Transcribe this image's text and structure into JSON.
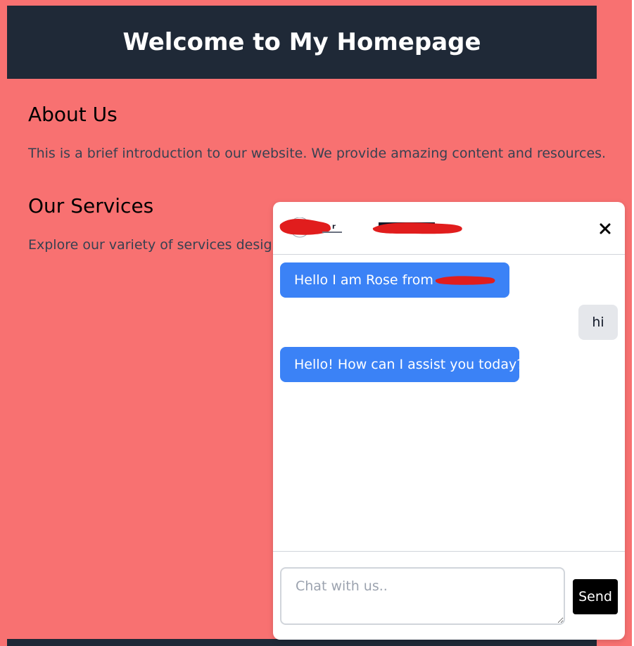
{
  "header": {
    "title": "Welcome to My Homepage"
  },
  "about": {
    "heading": "About Us",
    "text": "This is a brief introduction to our website. We provide amazing content and resources."
  },
  "services": {
    "heading": "Our Services",
    "text": "Explore our variety of services designed"
  },
  "chat": {
    "close_icon": "close-icon",
    "messages": [
      {
        "role": "bot",
        "text": "Hello I am Rose from"
      },
      {
        "role": "user",
        "text": "hi"
      },
      {
        "role": "bot",
        "text": "Hello! How can I assist you today?"
      }
    ],
    "input": {
      "placeholder": "Chat with us..",
      "value": ""
    },
    "send_label": "Send"
  },
  "colors": {
    "page_bg": "#f87171",
    "header_bg": "#1f2937",
    "bot_bubble": "#3b82f6",
    "user_bubble": "#e5e7eb",
    "redaction": "#e11d1d",
    "send_button": "#000000"
  }
}
